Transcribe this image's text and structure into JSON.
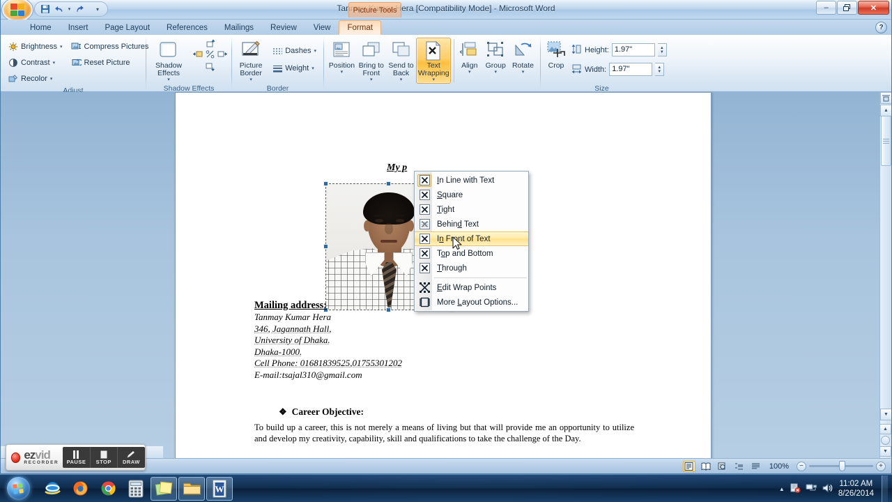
{
  "window": {
    "title": "Tanmay Kumar Hera [Compatibility Mode] - Microsoft Word",
    "contextual_tab_title": "Picture Tools",
    "minimize_label": "–",
    "restore_label": "❐",
    "close_label": "✕",
    "help_label": "?"
  },
  "quick_access": {
    "office_button": "Office Button",
    "save": "Save",
    "undo": "Undo",
    "undo_caret": "▾",
    "redo": "Redo",
    "customize": "▾"
  },
  "tabs": [
    {
      "label": "Home",
      "active": false
    },
    {
      "label": "Insert",
      "active": false
    },
    {
      "label": "Page Layout",
      "active": false
    },
    {
      "label": "References",
      "active": false
    },
    {
      "label": "Mailings",
      "active": false
    },
    {
      "label": "Review",
      "active": false
    },
    {
      "label": "View",
      "active": false
    },
    {
      "label": "Format",
      "active": true
    }
  ],
  "ribbon": {
    "groups": [
      {
        "name": "Adjust",
        "label": "Adjust"
      },
      {
        "name": "Shadow Effects",
        "label": "Shadow Effects"
      },
      {
        "name": "Border",
        "label": "Border"
      },
      {
        "name": "Arrange",
        "label": ""
      },
      {
        "name": "Size",
        "label": "Size"
      }
    ],
    "adjust": {
      "brightness": "Brightness",
      "contrast": "Contrast",
      "recolor": "Recolor",
      "compress_pictures": "Compress Pictures",
      "reset_picture": "Reset Picture",
      "caret": "▾"
    },
    "shadow_effects": {
      "button_line1": "Shadow",
      "button_line2": "Effects",
      "caret": "▾"
    },
    "border": {
      "picture_border_line1": "Picture",
      "picture_border_line2": "Border",
      "dashes": "Dashes",
      "weight": "Weight",
      "caret": "▾"
    },
    "arrange": {
      "position": "Position",
      "bring_to_front_line1": "Bring to",
      "bring_to_front_line2": "Front",
      "send_to_back_line1": "Send to",
      "send_to_back_line2": "Back",
      "text_wrapping_line1": "Text",
      "text_wrapping_line2": "Wrapping",
      "align": "Align",
      "group": "Group",
      "rotate": "Rotate",
      "caret": "▾"
    },
    "size": {
      "crop": "Crop",
      "height_label": "Height:",
      "height_value": "1.97\"",
      "width_label": "Width:",
      "width_value": "1.97\"",
      "up_arrow": "▲",
      "down_arrow": "▼"
    }
  },
  "wrap_menu": {
    "items": [
      {
        "label": "In Line with Text",
        "underline_index": 0,
        "state": "checked"
      },
      {
        "label": "Square",
        "underline_index": 0,
        "state": "normal"
      },
      {
        "label": "Tight",
        "underline_index": 0,
        "state": "normal"
      },
      {
        "label": "Behind Text",
        "underline_index": 5,
        "state": "normal"
      },
      {
        "label": "In Front of Text",
        "underline_index": 1,
        "state": "hover"
      },
      {
        "label": "Top and Bottom",
        "underline_index": 1,
        "state": "normal"
      },
      {
        "label": "Through",
        "underline_index": 0,
        "state": "normal"
      },
      {
        "label": "Edit Wrap Points",
        "underline_index": 0,
        "state": "normal"
      },
      {
        "label": "More Layout Options...",
        "underline_index": 5,
        "state": "normal"
      }
    ]
  },
  "document": {
    "heading": "My p",
    "mailing_address_heading": "Mailing address:",
    "address_lines": [
      "Tanmay Kumar Hera",
      "346, Jagannath Hall,",
      "University of Dhaka.",
      "Dhaka-1000.",
      "Cell Phone:  01681839525,01755301202",
      "E-mail:tsajal310@gmail.com"
    ],
    "career_bullet": "❖",
    "career_heading": "Career Objective:",
    "career_body": "To build up a career, this is not merely a means of living but that will provide me an opportunity to utilize and develop my creativity, capability, skill and qualifications to take the challenge of the Day."
  },
  "status_bar": {
    "view_buttons": [
      "Print Layout",
      "Full Screen Reading",
      "Web Layout",
      "Outline",
      "Draft"
    ],
    "zoom_percent": "100%",
    "zoom_out": "−",
    "zoom_in": "+"
  },
  "ezvid": {
    "brand_ez": "ez",
    "brand_vid": "vid",
    "brand_sub": "RECORDER",
    "buttons": [
      "PAUSE",
      "STOP",
      "DRAW"
    ]
  },
  "taskbar": {
    "start": "Start",
    "items": [
      {
        "name": "internet-explorer",
        "state": "pinned"
      },
      {
        "name": "firefox",
        "state": "pinned"
      },
      {
        "name": "chrome",
        "state": "pinned"
      },
      {
        "name": "calculator",
        "state": "pinned"
      },
      {
        "name": "sticky-notes",
        "state": "running"
      },
      {
        "name": "file-explorer",
        "state": "running"
      },
      {
        "name": "word",
        "state": "running"
      }
    ],
    "tray": {
      "show_hidden": "▲"
    },
    "clock_time": "11:02 AM",
    "clock_date": "8/26/2014"
  }
}
